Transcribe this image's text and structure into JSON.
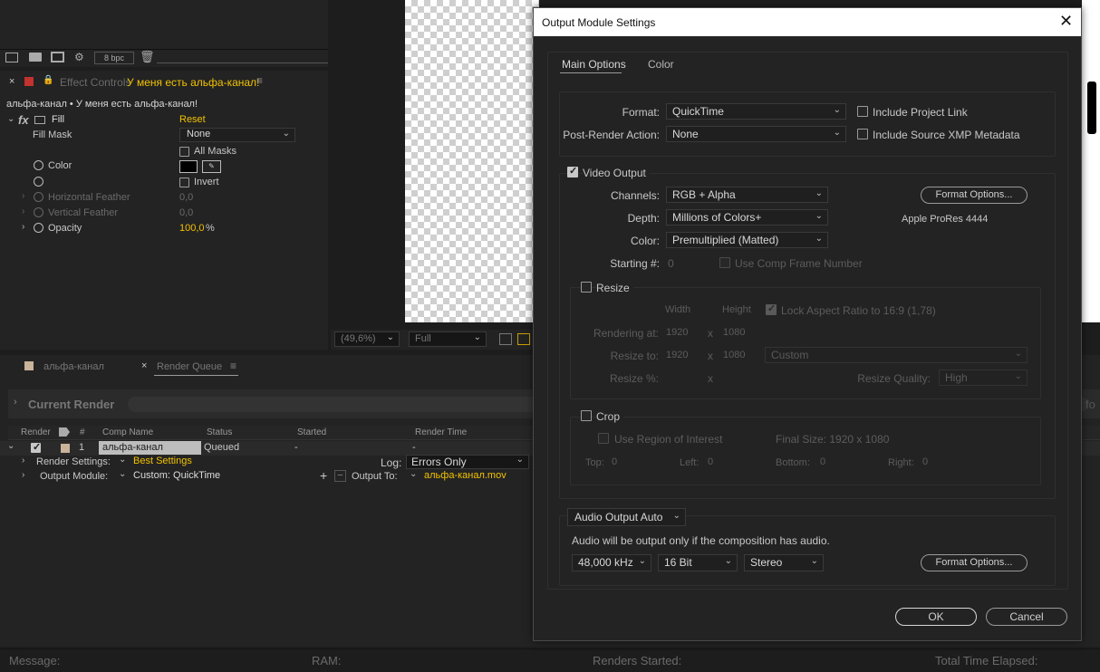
{
  "project_toolbar": {
    "bpc_label": "8 bpc"
  },
  "effect_controls": {
    "tab_label": "Effect Controls",
    "layer_name": "У меня есть альфа-канал!",
    "breadcrumb": "альфа-канал • У меня есть альфа-канал!",
    "effect_name": "Fill",
    "reset_label": "Reset",
    "props": [
      {
        "label": "Fill Mask",
        "value": "None"
      },
      {
        "label": "All Masks"
      },
      {
        "label": "Color"
      },
      {
        "label": "Invert"
      },
      {
        "label": "Horizontal Feather",
        "value": "0,0"
      },
      {
        "label": "Vertical Feather",
        "value": "0,0"
      },
      {
        "label": "Opacity",
        "value": "100,0",
        "unit": "%"
      }
    ]
  },
  "viewer": {
    "zoom": "(49,6%)",
    "resolution": "Full"
  },
  "timeline_tabs": [
    {
      "label": "альфа-канал"
    },
    {
      "label": "Render Queue"
    }
  ],
  "render_queue": {
    "current_render_label": "Current Render",
    "columns": [
      "Render",
      "#",
      "Comp Name",
      "Status",
      "Started",
      "Render Time"
    ],
    "row": {
      "num": "1",
      "comp_name": "альфа-канал",
      "status": "Queued",
      "started": "-",
      "render_time": "-"
    },
    "render_settings_label": "Render Settings:",
    "render_settings_value": "Best Settings",
    "log_label": "Log:",
    "log_value": "Errors Only",
    "output_module_label": "Output Module:",
    "output_module_value": "Custom: QuickTime",
    "output_to_label": "Output To:",
    "output_to_value": "альфа-канал.mov",
    "info_fragment": "fo"
  },
  "status_bar": {
    "message_label": "Message:",
    "ram_label": "RAM:",
    "renders_started_label": "Renders Started:",
    "total_time_label": "Total Time Elapsed:"
  },
  "dialog": {
    "title": "Output Module Settings",
    "tabs": [
      "Main Options",
      "Color"
    ],
    "format_label": "Format:",
    "format_value": "QuickTime",
    "post_render_label": "Post-Render Action:",
    "post_render_value": "None",
    "include_project_link": "Include Project Link",
    "include_xmp": "Include Source XMP Metadata",
    "video_output_label": "Video Output",
    "channels_label": "Channels:",
    "channels_value": "RGB + Alpha",
    "depth_label": "Depth:",
    "depth_value": "Millions of Colors+",
    "color_label": "Color:",
    "color_value": "Premultiplied (Matted)",
    "starting_label": "Starting #:",
    "starting_value": "0",
    "use_comp_frame": "Use Comp Frame Number",
    "format_options_label": "Format Options...",
    "codec_label": "Apple ProRes 4444",
    "resize_label": "Resize",
    "width_label": "Width",
    "height_label": "Height",
    "lock_aspect": "Lock Aspect Ratio to 16:9 (1,78)",
    "rendering_at_label": "Rendering at:",
    "rendering_w": "1920",
    "rendering_h": "1080",
    "resize_to_label": "Resize to:",
    "resize_w": "1920",
    "resize_h": "1080",
    "resize_preset": "Custom",
    "resize_pct_label": "Resize %:",
    "times": "x",
    "resize_quality_label": "Resize Quality:",
    "resize_quality_value": "High",
    "crop_label": "Crop",
    "use_roi": "Use Region of Interest",
    "final_size": "Final Size: 1920 x 1080",
    "top_label": "Top:",
    "top_value": "0",
    "left_label": "Left:",
    "left_value": "0",
    "bottom_label": "Bottom:",
    "bottom_value": "0",
    "right_label": "Right:",
    "right_value": "0",
    "audio_output_value": "Audio Output Auto",
    "audio_note": "Audio will be output only if the composition has audio.",
    "sample_rate": "48,000 kHz",
    "bit_depth": "16 Bit",
    "channels_audio": "Stereo",
    "ok_label": "OK",
    "cancel_label": "Cancel"
  }
}
